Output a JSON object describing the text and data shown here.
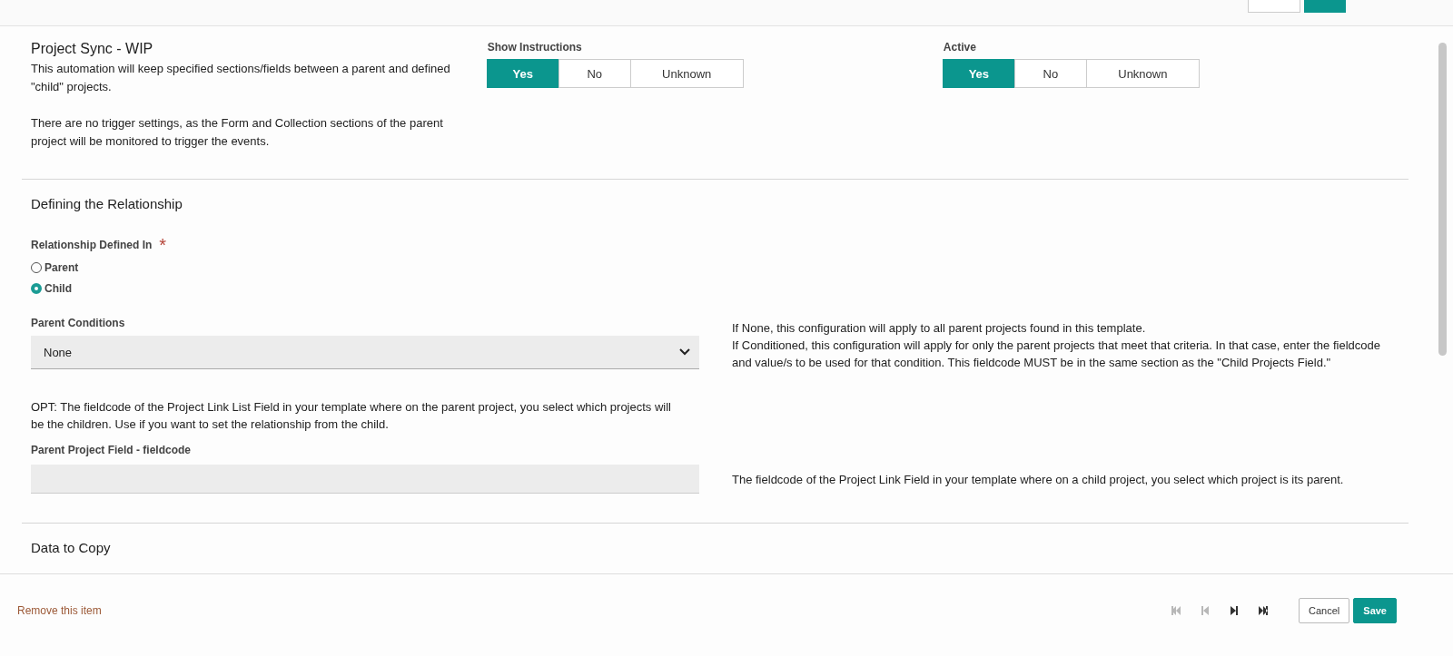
{
  "header": {
    "title": "Project Sync - WIP",
    "description": [
      "This automation will keep specified sections/fields between a parent and defined \"child\" projects.",
      "There are no trigger settings, as the Form and Collection sections of the parent project will be monitored to trigger the events."
    ]
  },
  "toggles": [
    {
      "label": "Show Instructions",
      "options": [
        {
          "label": "Yes",
          "selected": true
        },
        {
          "label": "No",
          "selected": false
        },
        {
          "label": "Unknown",
          "selected": false
        }
      ]
    },
    {
      "label": "Active",
      "options": [
        {
          "label": "Yes",
          "selected": true
        },
        {
          "label": "No",
          "selected": false
        },
        {
          "label": "Unknown",
          "selected": false
        }
      ]
    }
  ],
  "relationship": {
    "heading": "Defining the Relationship",
    "label": "Relationship Defined In",
    "required": "*",
    "options": [
      {
        "label": "Parent",
        "selected": false
      },
      {
        "label": "Child",
        "selected": true
      }
    ],
    "parent_conditions": {
      "label": "Parent Conditions",
      "value": "None",
      "help": [
        "If None, this configuration will apply to all parent projects found in this template.",
        "If Conditioned, this configuration will apply for only the parent projects that meet that criteria. In that case, enter the fieldcode and value/s to be used for that condition. This fieldcode MUST be in the same section as the \"Child Projects Field.\""
      ]
    },
    "opt_note": "OPT: The fieldcode of the Project Link List Field in your template where on the parent project, you select which projects will be the children. Use if you want to set the relationship from the child.",
    "parent_field": {
      "label": "Parent Project Field - fieldcode",
      "help": "The fieldcode of the Project Link Field in your template where on a child project, you select which project is its parent."
    }
  },
  "next_section": {
    "heading": "Data to Copy"
  },
  "footer": {
    "remove_link": "Remove this item",
    "pager": [
      {
        "kind": "first",
        "disabled": true
      },
      {
        "kind": "prev",
        "disabled": true
      },
      {
        "kind": "next",
        "disabled": false
      },
      {
        "kind": "last",
        "disabled": false
      }
    ],
    "buttons": [
      {
        "label": "Cancel",
        "kind": "secondary"
      },
      {
        "label": "Save",
        "kind": "primary"
      }
    ]
  }
}
